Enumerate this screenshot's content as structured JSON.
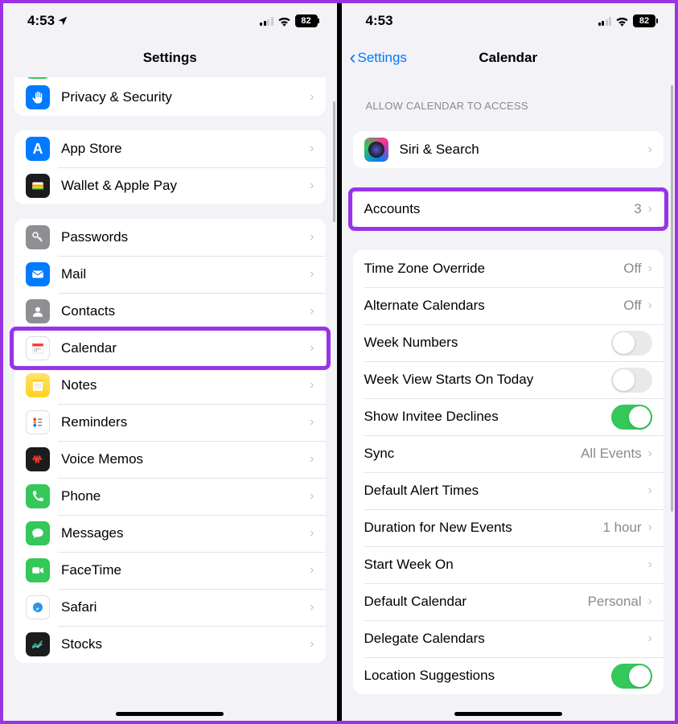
{
  "status": {
    "time": "4:53",
    "battery": "82"
  },
  "left": {
    "title": "Settings",
    "groups": [
      {
        "partialTop": true,
        "rows": [
          {
            "icon": true,
            "bg": "bg-green",
            "glyph": "partial",
            "label": "",
            "chevron": false
          },
          {
            "icon": true,
            "bg": "bg-blue",
            "glyph": "hand",
            "label": "Privacy & Security",
            "chevron": true,
            "name": "settings-privacy"
          }
        ]
      },
      {
        "rows": [
          {
            "icon": true,
            "bg": "bg-blue",
            "glyph": "A",
            "label": "App Store",
            "chevron": true,
            "name": "settings-appstore"
          },
          {
            "icon": true,
            "bg": "bg-dark",
            "glyph": "wallet",
            "label": "Wallet & Apple Pay",
            "chevron": true,
            "name": "settings-wallet"
          }
        ]
      },
      {
        "rows": [
          {
            "icon": true,
            "bg": "bg-gray",
            "glyph": "key",
            "label": "Passwords",
            "chevron": true,
            "name": "settings-passwords"
          },
          {
            "icon": true,
            "bg": "bg-blue",
            "glyph": "mail",
            "label": "Mail",
            "chevron": true,
            "name": "settings-mail"
          },
          {
            "icon": true,
            "bg": "bg-gray",
            "glyph": "contact",
            "label": "Contacts",
            "chevron": true,
            "name": "settings-contacts"
          },
          {
            "icon": true,
            "bg": "bg-white",
            "glyph": "cal",
            "label": "Calendar",
            "chevron": true,
            "highlight": true,
            "name": "settings-calendar"
          },
          {
            "icon": true,
            "bg": "bg-yellow",
            "glyph": "notes",
            "label": "Notes",
            "chevron": true,
            "name": "settings-notes"
          },
          {
            "icon": true,
            "bg": "bg-white",
            "glyph": "reminders",
            "label": "Reminders",
            "chevron": true,
            "name": "settings-reminders"
          },
          {
            "icon": true,
            "bg": "bg-dark",
            "glyph": "voice",
            "label": "Voice Memos",
            "chevron": true,
            "name": "settings-voicememos"
          },
          {
            "icon": true,
            "bg": "bg-green",
            "glyph": "phone",
            "label": "Phone",
            "chevron": true,
            "name": "settings-phone"
          },
          {
            "icon": true,
            "bg": "bg-green",
            "glyph": "msg",
            "label": "Messages",
            "chevron": true,
            "name": "settings-messages"
          },
          {
            "icon": true,
            "bg": "bg-green",
            "glyph": "ft",
            "label": "FaceTime",
            "chevron": true,
            "name": "settings-facetime"
          },
          {
            "icon": true,
            "bg": "bg-white",
            "glyph": "safari",
            "label": "Safari",
            "chevron": true,
            "name": "settings-safari"
          },
          {
            "icon": true,
            "bg": "bg-dark",
            "glyph": "stocks",
            "label": "Stocks",
            "chevron": true,
            "name": "settings-stocks"
          }
        ]
      }
    ]
  },
  "right": {
    "back": "Settings",
    "title": "Calendar",
    "sectionHeader": "ALLOW CALENDAR TO ACCESS",
    "groups": [
      {
        "rows": [
          {
            "icon": true,
            "bg": "bg-grad-siri",
            "glyph": "",
            "label": "Siri & Search",
            "chevron": true,
            "name": "calendar-siri"
          }
        ]
      },
      {
        "rows": [
          {
            "icon": false,
            "label": "Accounts",
            "detail": "3",
            "chevron": true,
            "highlight": true,
            "name": "calendar-accounts"
          }
        ]
      },
      {
        "rows": [
          {
            "icon": false,
            "label": "Time Zone Override",
            "detail": "Off",
            "chevron": true,
            "name": "calendar-timezone"
          },
          {
            "icon": false,
            "label": "Alternate Calendars",
            "detail": "Off",
            "chevron": true,
            "name": "calendar-alternate"
          },
          {
            "icon": false,
            "label": "Week Numbers",
            "toggle": false,
            "name": "calendar-weeknumbers"
          },
          {
            "icon": false,
            "label": "Week View Starts On Today",
            "toggle": false,
            "name": "calendar-weekview"
          },
          {
            "icon": false,
            "label": "Show Invitee Declines",
            "toggle": true,
            "name": "calendar-declines"
          },
          {
            "icon": false,
            "label": "Sync",
            "detail": "All Events",
            "chevron": true,
            "name": "calendar-sync"
          },
          {
            "icon": false,
            "label": "Default Alert Times",
            "chevron": true,
            "name": "calendar-alerts"
          },
          {
            "icon": false,
            "label": "Duration for New Events",
            "detail": "1 hour",
            "chevron": true,
            "name": "calendar-duration"
          },
          {
            "icon": false,
            "label": "Start Week On",
            "chevron": true,
            "name": "calendar-startweek"
          },
          {
            "icon": false,
            "label": "Default Calendar",
            "detail": "Personal",
            "chevron": true,
            "name": "calendar-default"
          },
          {
            "icon": false,
            "label": "Delegate Calendars",
            "chevron": true,
            "name": "calendar-delegate"
          },
          {
            "icon": false,
            "label": "Location Suggestions",
            "toggle": true,
            "name": "calendar-location"
          }
        ]
      }
    ]
  }
}
